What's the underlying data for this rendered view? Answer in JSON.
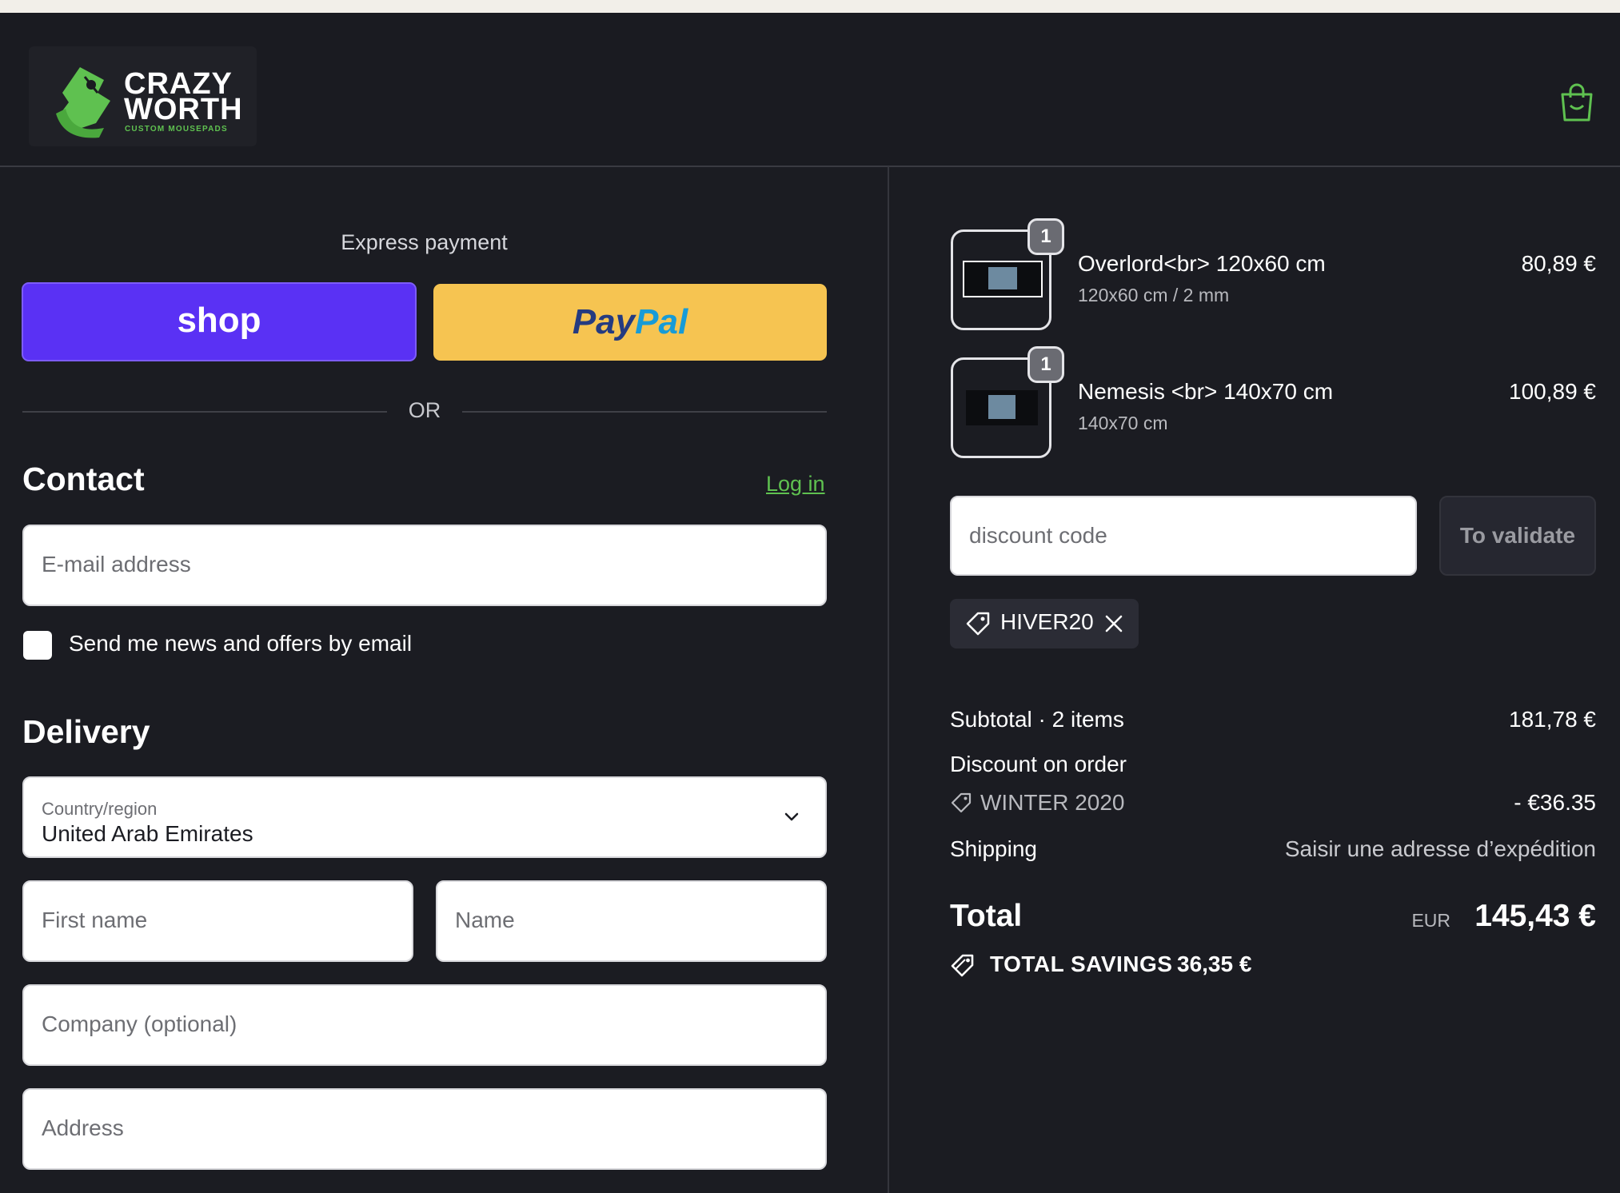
{
  "brand": {
    "name_line1": "CRAZY",
    "name_line2": "WORTH",
    "tagline": "CUSTOM MOUSEPADS",
    "accent_color": "#5fc150"
  },
  "header": {
    "cart_icon": "shopping-bag-icon"
  },
  "express": {
    "title": "Express payment",
    "shop_label": "shop",
    "paypal_label_a": "Pay",
    "paypal_label_b": "Pal",
    "or_label": "OR"
  },
  "contact": {
    "heading": "Contact",
    "login_label": "Log in",
    "email_placeholder": "E-mail address",
    "newsletter_label": "Send me news and offers by email"
  },
  "delivery": {
    "heading": "Delivery",
    "country_label": "Country/region",
    "country_value": "United Arab Emirates",
    "first_name_placeholder": "First name",
    "last_name_placeholder": "Name",
    "company_placeholder": "Company (optional)",
    "address_placeholder": "Address"
  },
  "cart": {
    "items": [
      {
        "title": "Overlord<br> 120x60 cm",
        "variant": "120x60 cm / 2 mm",
        "price": "80,89 €",
        "qty": "1"
      },
      {
        "title": "Nemesis <br> 140x70 cm",
        "variant": "140x70 cm",
        "price": "100,89 €",
        "qty": "1"
      }
    ],
    "discount_placeholder": "discount code",
    "validate_label": "To validate",
    "applied_code": "HIVER20"
  },
  "summary": {
    "subtotal_label": "Subtotal · 2 items",
    "subtotal_value": "181,78 €",
    "discount_label": "Discount on order",
    "discount_code": "WINTER 2020",
    "discount_value": "- €36.35",
    "shipping_label": "Shipping",
    "shipping_value": "Saisir une adresse d’expédition",
    "total_label": "Total",
    "total_currency": "EUR",
    "total_value": "145,43 €",
    "savings_label": "TOTAL SAVINGS",
    "savings_value": "36,35 €"
  }
}
